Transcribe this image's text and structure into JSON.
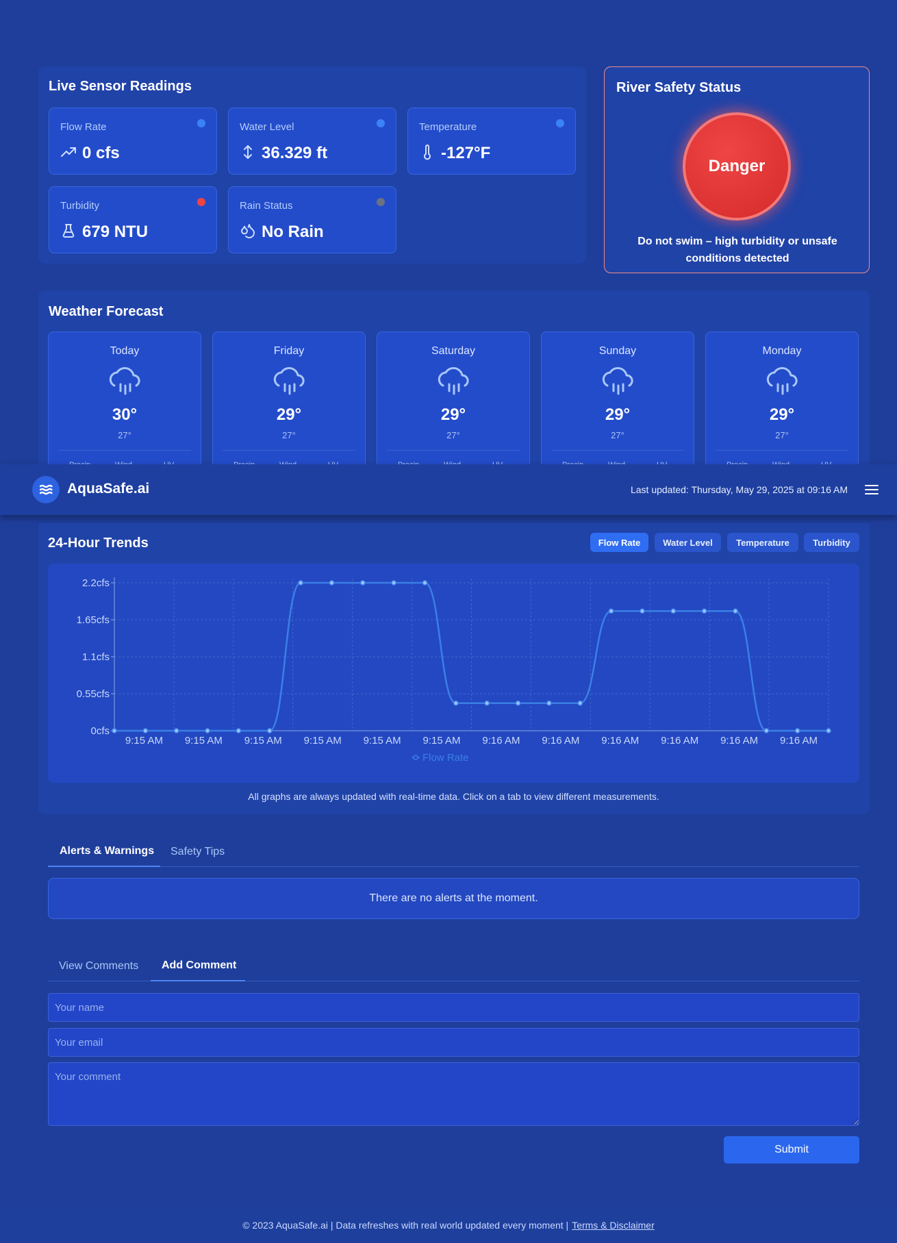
{
  "header": {
    "brand": "AquaSafe.ai",
    "last_updated": "Last updated: Thursday, May 29, 2025 at 09:16 AM"
  },
  "sensors": {
    "title": "Live Sensor Readings",
    "cards": [
      {
        "label": "Flow Rate",
        "value": "0 cfs",
        "icon": "trending-up-icon",
        "status_color": "#3b82f6"
      },
      {
        "label": "Water Level",
        "value": "36.329 ft",
        "icon": "arrows-vertical-icon",
        "status_color": "#3b82f6"
      },
      {
        "label": "Temperature",
        "value": "-127°F",
        "icon": "thermometer-icon",
        "status_color": "#3b82f6"
      },
      {
        "label": "Turbidity",
        "value": "679 NTU",
        "icon": "flask-icon",
        "status_color": "#ef4444"
      },
      {
        "label": "Rain Status",
        "value": "No Rain",
        "icon": "droplets-icon",
        "status_color": "#6b7280"
      }
    ]
  },
  "safety": {
    "title": "River Safety Status",
    "status": "Danger",
    "message": "Do not swim – high turbidity or unsafe conditions detected",
    "status_color": "#e53535"
  },
  "weather": {
    "title": "Weather Forecast",
    "days": [
      {
        "day": "Today",
        "high": "30°",
        "low": "27°",
        "icon": "cloud-rain-icon"
      },
      {
        "day": "Friday",
        "high": "29°",
        "low": "27°",
        "icon": "cloud-rain-icon"
      },
      {
        "day": "Saturday",
        "high": "29°",
        "low": "27°",
        "icon": "cloud-rain-icon"
      },
      {
        "day": "Sunday",
        "high": "29°",
        "low": "27°",
        "icon": "cloud-rain-icon"
      },
      {
        "day": "Monday",
        "high": "29°",
        "low": "27°",
        "icon": "cloud-rain-icon"
      }
    ],
    "detail_labels": [
      "Precip",
      "Wind",
      "UV"
    ]
  },
  "trends": {
    "title": "24-Hour Trends",
    "tabs": [
      "Flow Rate",
      "Water Level",
      "Temperature",
      "Turbidity"
    ],
    "active_tab": "Flow Rate",
    "note": "All graphs are always updated with real-time data. Click on a tab to view different measurements."
  },
  "chart_data": {
    "type": "line",
    "x": [
      "9:15 AM",
      "9:15 AM",
      "9:15 AM",
      "9:15 AM",
      "9:15 AM",
      "9:15 AM",
      "9:15 AM",
      "9:15 AM",
      "9:15 AM",
      "9:15 AM",
      "9:15 AM",
      "9:15 AM",
      "9:16 AM",
      "9:16 AM",
      "9:16 AM",
      "9:16 AM",
      "9:16 AM",
      "9:16 AM",
      "9:16 AM",
      "9:16 AM",
      "9:16 AM",
      "9:16 AM",
      "9:16 AM",
      "9:16 AM"
    ],
    "x_tick_labels": [
      "9:15 AM",
      "9:15 AM",
      "9:15 AM",
      "9:15 AM",
      "9:15 AM",
      "9:15 AM",
      "9:16 AM",
      "9:16 AM",
      "9:16 AM",
      "9:16 AM",
      "9:16 AM",
      "9:16 AM"
    ],
    "series": [
      {
        "name": "Flow Rate",
        "values": [
          0,
          0,
          0,
          0,
          0,
          0,
          2.2,
          2.2,
          2.2,
          2.2,
          2.2,
          0.41,
          0.41,
          0.41,
          0.41,
          0.41,
          1.78,
          1.78,
          1.78,
          1.78,
          1.78,
          0,
          0,
          0
        ],
        "color": "#3b7fe6"
      }
    ],
    "y_tick_labels": [
      "0cfs",
      "0.55cfs",
      "1.1cfs",
      "1.65cfs",
      "2.2cfs"
    ],
    "ylim": [
      0,
      2.2
    ],
    "grid": true,
    "legend_position": "bottom"
  },
  "alerts": {
    "tabs": [
      "Alerts & Warnings",
      "Safety Tips"
    ],
    "active_tab": "Alerts & Warnings",
    "message": "There are no alerts at the moment."
  },
  "comments": {
    "tabs": [
      "View Comments",
      "Add Comment"
    ],
    "active_tab": "Add Comment",
    "name_placeholder": "Your name",
    "email_placeholder": "Your email",
    "comment_placeholder": "Your comment",
    "submit_label": "Submit"
  },
  "footer": {
    "text": "© 2023 AquaSafe.ai | Data refreshes with real world updated every moment |",
    "link": "Terms & Disclaimer"
  }
}
